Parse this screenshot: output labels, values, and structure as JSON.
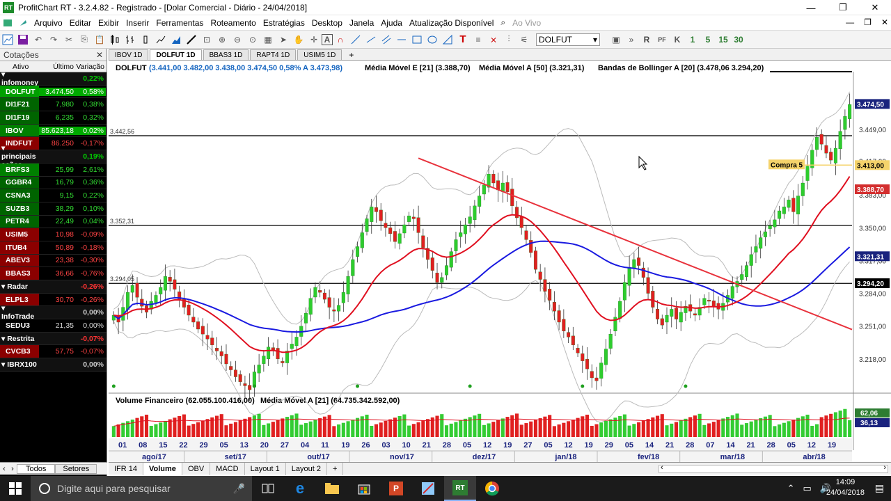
{
  "window": {
    "title": "ProfitChart RT - 3.2.4.82 - Registrado - [Dolar Comercial - Diário - 24/04/2018]",
    "controls": [
      "—",
      "❐",
      "✕"
    ],
    "icon_label": "RT"
  },
  "menu": [
    "Arquivo",
    "Editar",
    "Exibir",
    "Inserir",
    "Ferramentas",
    "Roteamento",
    "Estratégias",
    "Desktop",
    "Janela",
    "Ajuda",
    "Atualização Disponível",
    "Ao Vivo"
  ],
  "toolbar": {
    "ticker": "DOLFUT",
    "period_buttons": [
      "1",
      "5",
      "15",
      "30"
    ],
    "icons": [
      "chart-icon",
      "save-icon",
      "undo-icon",
      "redo-icon",
      "cut-icon",
      "copy-icon",
      "paste-icon",
      "candles-icon",
      "line-icon",
      "zoom-in-icon",
      "zoom-out-icon",
      "cursor-icon",
      "hand-icon",
      "cross-icon",
      "text-icon",
      "magnet-icon",
      "trendline-icon",
      "rect-icon",
      "ellipse-icon",
      "fibo-icon"
    ]
  },
  "quotes_panel": {
    "title": "Cotações",
    "close": "✕",
    "columns": [
      "Ativo",
      "Último",
      "Variação"
    ],
    "rows": [
      {
        "type": "group",
        "name": "infomoney",
        "last": "",
        "change": "0,22%",
        "color": "#00cc00"
      },
      {
        "type": "asset",
        "name": "DOLFUT",
        "last": "3.474,50",
        "change": "0,58%",
        "bg": "#00a000",
        "highlight": true
      },
      {
        "type": "asset",
        "name": "DI1F21",
        "last": "7,980",
        "change": "0,38%",
        "bg": "#006400"
      },
      {
        "type": "asset",
        "name": "DI1F19",
        "last": "6,235",
        "change": "0,32%",
        "bg": "#006400"
      },
      {
        "type": "asset",
        "name": "IBOV",
        "last": "85.623,18",
        "change": "0,02%",
        "bg": "#008000",
        "highlight": true
      },
      {
        "type": "asset",
        "name": "INDFUT",
        "last": "86.250",
        "change": "-0,17%",
        "bg": "#8b0000"
      },
      {
        "type": "group",
        "name": "principais ações",
        "last": "",
        "change": "0,19%",
        "color": "#00cc00"
      },
      {
        "type": "asset",
        "name": "BRFS3",
        "last": "25,99",
        "change": "2,61%",
        "bg": "#008000"
      },
      {
        "type": "asset",
        "name": "GGBR4",
        "last": "16,79",
        "change": "0,36%",
        "bg": "#006400"
      },
      {
        "type": "asset",
        "name": "CSNA3",
        "last": "9,15",
        "change": "0,22%",
        "bg": "#006400"
      },
      {
        "type": "asset",
        "name": "SUZB3",
        "last": "38,29",
        "change": "0,10%",
        "bg": "#006400"
      },
      {
        "type": "asset",
        "name": "PETR4",
        "last": "22,49",
        "change": "0,04%",
        "bg": "#006400"
      },
      {
        "type": "asset",
        "name": "USIM5",
        "last": "10,98",
        "change": "-0,09%",
        "bg": "#8b0000"
      },
      {
        "type": "asset",
        "name": "ITUB4",
        "last": "50,89",
        "change": "-0,18%",
        "bg": "#8b0000"
      },
      {
        "type": "asset",
        "name": "ABEV3",
        "last": "23,38",
        "change": "-0,30%",
        "bg": "#8b0000"
      },
      {
        "type": "asset",
        "name": "BBAS3",
        "last": "36,66",
        "change": "-0,76%",
        "bg": "#8b0000"
      },
      {
        "type": "group",
        "name": "Radar",
        "last": "",
        "change": "-0,26%",
        "color": "#ff3333"
      },
      {
        "type": "asset",
        "name": "ELPL3",
        "last": "30,70",
        "change": "-0,26%",
        "bg": "#8b0000"
      },
      {
        "type": "group",
        "name": "InfoTrade",
        "last": "",
        "change": "0,00%",
        "color": "#cccccc"
      },
      {
        "type": "asset",
        "name": "SEDU3",
        "last": "21,35",
        "change": "0,00%",
        "bg": "#000000"
      },
      {
        "type": "group",
        "name": "Restrita",
        "last": "",
        "change": "-0,07%",
        "color": "#ff3333"
      },
      {
        "type": "asset",
        "name": "CVCB3",
        "last": "57,75",
        "change": "-0,07%",
        "bg": "#8b0000"
      },
      {
        "type": "group",
        "name": "IBRX100",
        "last": "",
        "change": "0,00%",
        "color": "#cccccc"
      }
    ],
    "bottom_tabs": [
      "Todos",
      "Setores"
    ]
  },
  "chart_tabs": [
    "IBOV 1D",
    "DOLFUT 1D",
    "BBAS3 1D",
    "RAPT4 1D",
    "USIM5 1D"
  ],
  "active_chart_tab": 1,
  "chart_header": {
    "ticker": "DOLFUT",
    "ohlc": "(3.441,00  3.482,00  3.438,00  3.474,50  0,58%  A 3.473,98)",
    "ema": "Média Móvel E [21] (3.388,70)",
    "sma": "Média Móvel A [50] (3.321,31)",
    "boll": "Bandas de Bollinger A [20] (3.478,06  3.294,20)"
  },
  "volume_header": {
    "title": "Volume Financeiro (62.055.100.416,00)",
    "ma": "Média Móvel A [21] (64.735.342.592,00)"
  },
  "indicator_tabs": [
    "IFR 14",
    "Volume",
    "OBV",
    "MACD",
    "Layout 1",
    "Layout 2"
  ],
  "active_indicator_tab": 1,
  "chart_data": {
    "type": "candlestick",
    "y_axis_ticks": [
      "3.449,00",
      "3.417,00",
      "3.383,00",
      "3.350,00",
      "3.317,00",
      "3.284,00",
      "3.251,00",
      "3.218,00"
    ],
    "y_range": [
      3185,
      3500
    ],
    "horizontal_lines": [
      {
        "label": "3.442,56",
        "value": 3442.56
      },
      {
        "label": "3.352,31",
        "value": 3352.31
      },
      {
        "label": "3.294,05",
        "value": 3294.05
      }
    ],
    "price_tags": [
      {
        "label": "3.474,50",
        "value": 3474.5,
        "bg": "#1a237e",
        "fg": "#ffffff"
      },
      {
        "label": "3.413,00",
        "value": 3413.0,
        "bg": "#f5d36b",
        "fg": "#000000"
      },
      {
        "label": "3.388,70",
        "value": 3388.7,
        "bg": "#d32f2f",
        "fg": "#ffffff"
      },
      {
        "label": "3.321,31",
        "value": 3321.31,
        "bg": "#1a237e",
        "fg": "#ffffff"
      },
      {
        "label": "3.294,20",
        "value": 3294.2,
        "bg": "#000000",
        "fg": "#ffffff"
      }
    ],
    "order_label": "Compra 5",
    "volume_tags": [
      "62,06",
      "36,13"
    ],
    "x_day_labels": [
      "01",
      "08",
      "15",
      "22",
      "29",
      "05",
      "13",
      "20",
      "27",
      "04",
      "11",
      "19",
      "26",
      "03",
      "10",
      "21",
      "28",
      "05",
      "12",
      "19",
      "27",
      "05",
      "12",
      "19",
      "29",
      "05",
      "14",
      "21",
      "28",
      "07",
      "14",
      "21",
      "28",
      "05",
      "12",
      "19"
    ],
    "x_month_labels": [
      "ago/17",
      "set/17",
      "out/17",
      "nov/17",
      "dez/17",
      "jan/18",
      "fev/18",
      "mar/18",
      "abr/18"
    ],
    "trendline": {
      "from_index": 65,
      "from_value": 3420,
      "to_index": 175,
      "to_value": 3215
    },
    "candles": "generated_from_close_series",
    "close_series": [
      3262,
      3255,
      3270,
      3285,
      3292,
      3280,
      3271,
      3265,
      3276,
      3282,
      3290,
      3301,
      3296,
      3288,
      3278,
      3270,
      3262,
      3255,
      3248,
      3243,
      3238,
      3232,
      3226,
      3221,
      3213,
      3207,
      3200,
      3195,
      3191,
      3187,
      3205,
      3212,
      3221,
      3230,
      3227,
      3218,
      3214,
      3226,
      3233,
      3240,
      3251,
      3264,
      3279,
      3290,
      3285,
      3278,
      3270,
      3266,
      3272,
      3285,
      3301,
      3318,
      3331,
      3345,
      3359,
      3371,
      3366,
      3357,
      3350,
      3344,
      3336,
      3344,
      3353,
      3362,
      3359,
      3345,
      3330,
      3318,
      3307,
      3295,
      3300,
      3312,
      3326,
      3338,
      3345,
      3353,
      3361,
      3372,
      3382,
      3393,
      3404,
      3395,
      3388,
      3395,
      3386,
      3372,
      3360,
      3350,
      3338,
      3325,
      3308,
      3298,
      3286,
      3277,
      3266,
      3255,
      3246,
      3240,
      3232,
      3224,
      3216,
      3208,
      3199,
      3196,
      3214,
      3228,
      3243,
      3260,
      3276,
      3295,
      3310,
      3318,
      3312,
      3300,
      3284,
      3270,
      3258,
      3252,
      3262,
      3268,
      3258,
      3265,
      3271,
      3266,
      3262,
      3270,
      3279,
      3276,
      3271,
      3268,
      3274,
      3282,
      3291,
      3296,
      3303,
      3312,
      3323,
      3331,
      3340,
      3346,
      3352,
      3358,
      3367,
      3371,
      3378,
      3366,
      3382,
      3395,
      3412,
      3428,
      3441,
      3434,
      3425,
      3418,
      3430,
      3447,
      3462,
      3474
    ]
  }
}
